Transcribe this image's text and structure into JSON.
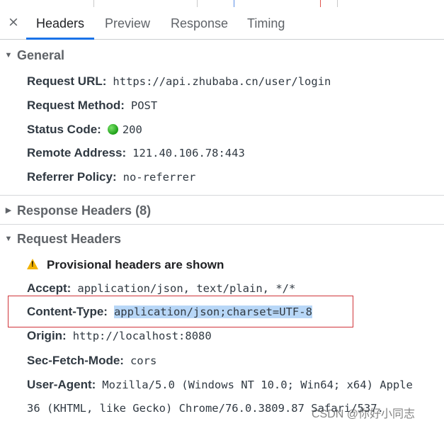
{
  "tabs": {
    "close_label": "×",
    "items": [
      {
        "label": "Headers"
      },
      {
        "label": "Preview"
      },
      {
        "label": "Response"
      },
      {
        "label": "Timing"
      }
    ]
  },
  "general": {
    "title": "General",
    "rows": [
      {
        "key": "Request URL:",
        "value": "https://api.zhubaba.cn/user/login"
      },
      {
        "key": "Request Method:",
        "value": "POST"
      },
      {
        "key": "Status Code:",
        "value": "200"
      },
      {
        "key": "Remote Address:",
        "value": "121.40.106.78:443"
      },
      {
        "key": "Referrer Policy:",
        "value": "no-referrer"
      }
    ]
  },
  "response_headers": {
    "title": "Response Headers (8)"
  },
  "request_headers": {
    "title": "Request Headers",
    "warning_text": "Provisional headers are shown",
    "rows": [
      {
        "key": "Accept:",
        "value": "application/json, text/plain, */*"
      },
      {
        "key": "Content-Type:",
        "value": "application/json;charset=UTF-8"
      },
      {
        "key": "Origin:",
        "value": "http://localhost:8080"
      },
      {
        "key": "Sec-Fetch-Mode:",
        "value": "cors"
      },
      {
        "key": "User-Agent:",
        "value": "Mozilla/5.0 (Windows NT 10.0; Win64; x64) Apple"
      }
    ],
    "user_agent_continued": "36 (KHTML, like Gecko) Chrome/76.0.3809.87 Safari/537.",
    "warning_glyph": "!"
  },
  "watermark": "CSDN @你好小同志",
  "colors": {
    "tab_underline": "#1a73e8",
    "status_ok": "#1c9e17",
    "selection_highlight": "#b8d7f7",
    "annotation_box": "#d0343a",
    "warning": "#f2b300"
  }
}
